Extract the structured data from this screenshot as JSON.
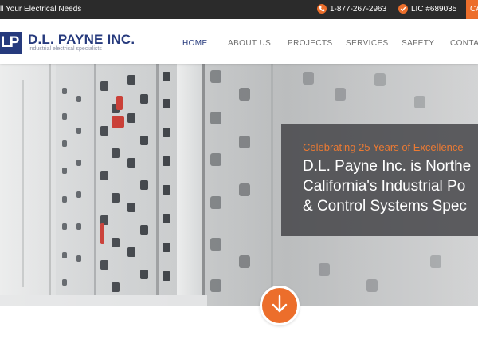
{
  "topbar": {
    "tagline": "ll Your Electrical Needs",
    "phone": "1-877-267-2963",
    "license": "LIC #689035",
    "cta_fragment": "CA"
  },
  "logo": {
    "mark": "LP",
    "name": "D.L. PAYNE INC.",
    "subtitle": "industrial electrical specialists"
  },
  "nav": {
    "items": [
      "HOME",
      "ABOUT US",
      "PROJECTS",
      "SERVICES",
      "SAFETY",
      "CONTAC"
    ],
    "active": "HOME"
  },
  "hero": {
    "eyebrow": "Celebrating 25 Years of Excellence",
    "headline_lines": [
      "D.L. Payne Inc. is Northe",
      "California's Industrial Po",
      "& Control Systems Spec"
    ]
  },
  "colors": {
    "brand_blue": "#263a7d",
    "accent_orange": "#ec6e2b",
    "topbar_bg": "#2b2b2b"
  },
  "icons": {
    "phone": "phone-icon",
    "license": "check-icon",
    "scroll": "arrow-down-icon"
  }
}
